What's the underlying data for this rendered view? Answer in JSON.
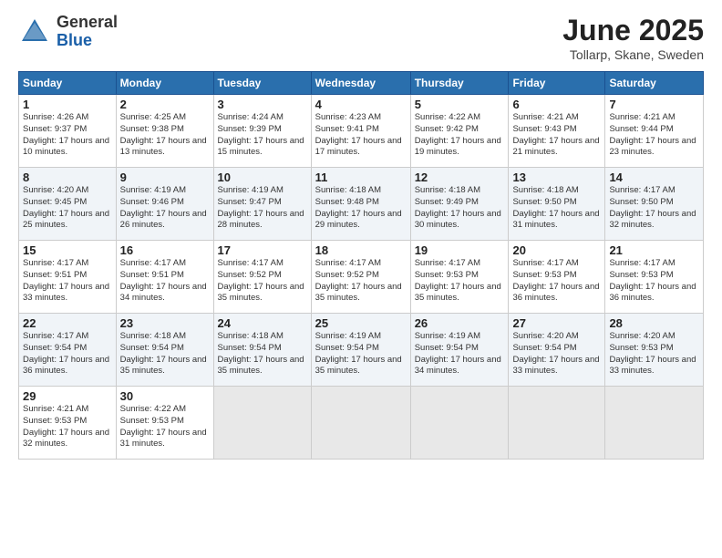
{
  "logo": {
    "general": "General",
    "blue": "Blue"
  },
  "title": "June 2025",
  "subtitle": "Tollarp, Skane, Sweden",
  "days": [
    "Sunday",
    "Monday",
    "Tuesday",
    "Wednesday",
    "Thursday",
    "Friday",
    "Saturday"
  ],
  "weeks": [
    [
      {
        "num": "1",
        "rise": "4:26 AM",
        "set": "9:37 PM",
        "daylight": "17 hours and 10 minutes."
      },
      {
        "num": "2",
        "rise": "4:25 AM",
        "set": "9:38 PM",
        "daylight": "17 hours and 13 minutes."
      },
      {
        "num": "3",
        "rise": "4:24 AM",
        "set": "9:39 PM",
        "daylight": "17 hours and 15 minutes."
      },
      {
        "num": "4",
        "rise": "4:23 AM",
        "set": "9:41 PM",
        "daylight": "17 hours and 17 minutes."
      },
      {
        "num": "5",
        "rise": "4:22 AM",
        "set": "9:42 PM",
        "daylight": "17 hours and 19 minutes."
      },
      {
        "num": "6",
        "rise": "4:21 AM",
        "set": "9:43 PM",
        "daylight": "17 hours and 21 minutes."
      },
      {
        "num": "7",
        "rise": "4:21 AM",
        "set": "9:44 PM",
        "daylight": "17 hours and 23 minutes."
      }
    ],
    [
      {
        "num": "8",
        "rise": "4:20 AM",
        "set": "9:45 PM",
        "daylight": "17 hours and 25 minutes."
      },
      {
        "num": "9",
        "rise": "4:19 AM",
        "set": "9:46 PM",
        "daylight": "17 hours and 26 minutes."
      },
      {
        "num": "10",
        "rise": "4:19 AM",
        "set": "9:47 PM",
        "daylight": "17 hours and 28 minutes."
      },
      {
        "num": "11",
        "rise": "4:18 AM",
        "set": "9:48 PM",
        "daylight": "17 hours and 29 minutes."
      },
      {
        "num": "12",
        "rise": "4:18 AM",
        "set": "9:49 PM",
        "daylight": "17 hours and 30 minutes."
      },
      {
        "num": "13",
        "rise": "4:18 AM",
        "set": "9:50 PM",
        "daylight": "17 hours and 31 minutes."
      },
      {
        "num": "14",
        "rise": "4:17 AM",
        "set": "9:50 PM",
        "daylight": "17 hours and 32 minutes."
      }
    ],
    [
      {
        "num": "15",
        "rise": "4:17 AM",
        "set": "9:51 PM",
        "daylight": "17 hours and 33 minutes."
      },
      {
        "num": "16",
        "rise": "4:17 AM",
        "set": "9:51 PM",
        "daylight": "17 hours and 34 minutes."
      },
      {
        "num": "17",
        "rise": "4:17 AM",
        "set": "9:52 PM",
        "daylight": "17 hours and 35 minutes."
      },
      {
        "num": "18",
        "rise": "4:17 AM",
        "set": "9:52 PM",
        "daylight": "17 hours and 35 minutes."
      },
      {
        "num": "19",
        "rise": "4:17 AM",
        "set": "9:53 PM",
        "daylight": "17 hours and 35 minutes."
      },
      {
        "num": "20",
        "rise": "4:17 AM",
        "set": "9:53 PM",
        "daylight": "17 hours and 36 minutes."
      },
      {
        "num": "21",
        "rise": "4:17 AM",
        "set": "9:53 PM",
        "daylight": "17 hours and 36 minutes."
      }
    ],
    [
      {
        "num": "22",
        "rise": "4:17 AM",
        "set": "9:54 PM",
        "daylight": "17 hours and 36 minutes."
      },
      {
        "num": "23",
        "rise": "4:18 AM",
        "set": "9:54 PM",
        "daylight": "17 hours and 35 minutes."
      },
      {
        "num": "24",
        "rise": "4:18 AM",
        "set": "9:54 PM",
        "daylight": "17 hours and 35 minutes."
      },
      {
        "num": "25",
        "rise": "4:19 AM",
        "set": "9:54 PM",
        "daylight": "17 hours and 35 minutes."
      },
      {
        "num": "26",
        "rise": "4:19 AM",
        "set": "9:54 PM",
        "daylight": "17 hours and 34 minutes."
      },
      {
        "num": "27",
        "rise": "4:20 AM",
        "set": "9:54 PM",
        "daylight": "17 hours and 33 minutes."
      },
      {
        "num": "28",
        "rise": "4:20 AM",
        "set": "9:53 PM",
        "daylight": "17 hours and 33 minutes."
      }
    ],
    [
      {
        "num": "29",
        "rise": "4:21 AM",
        "set": "9:53 PM",
        "daylight": "17 hours and 32 minutes."
      },
      {
        "num": "30",
        "rise": "4:22 AM",
        "set": "9:53 PM",
        "daylight": "17 hours and 31 minutes."
      },
      null,
      null,
      null,
      null,
      null
    ]
  ]
}
